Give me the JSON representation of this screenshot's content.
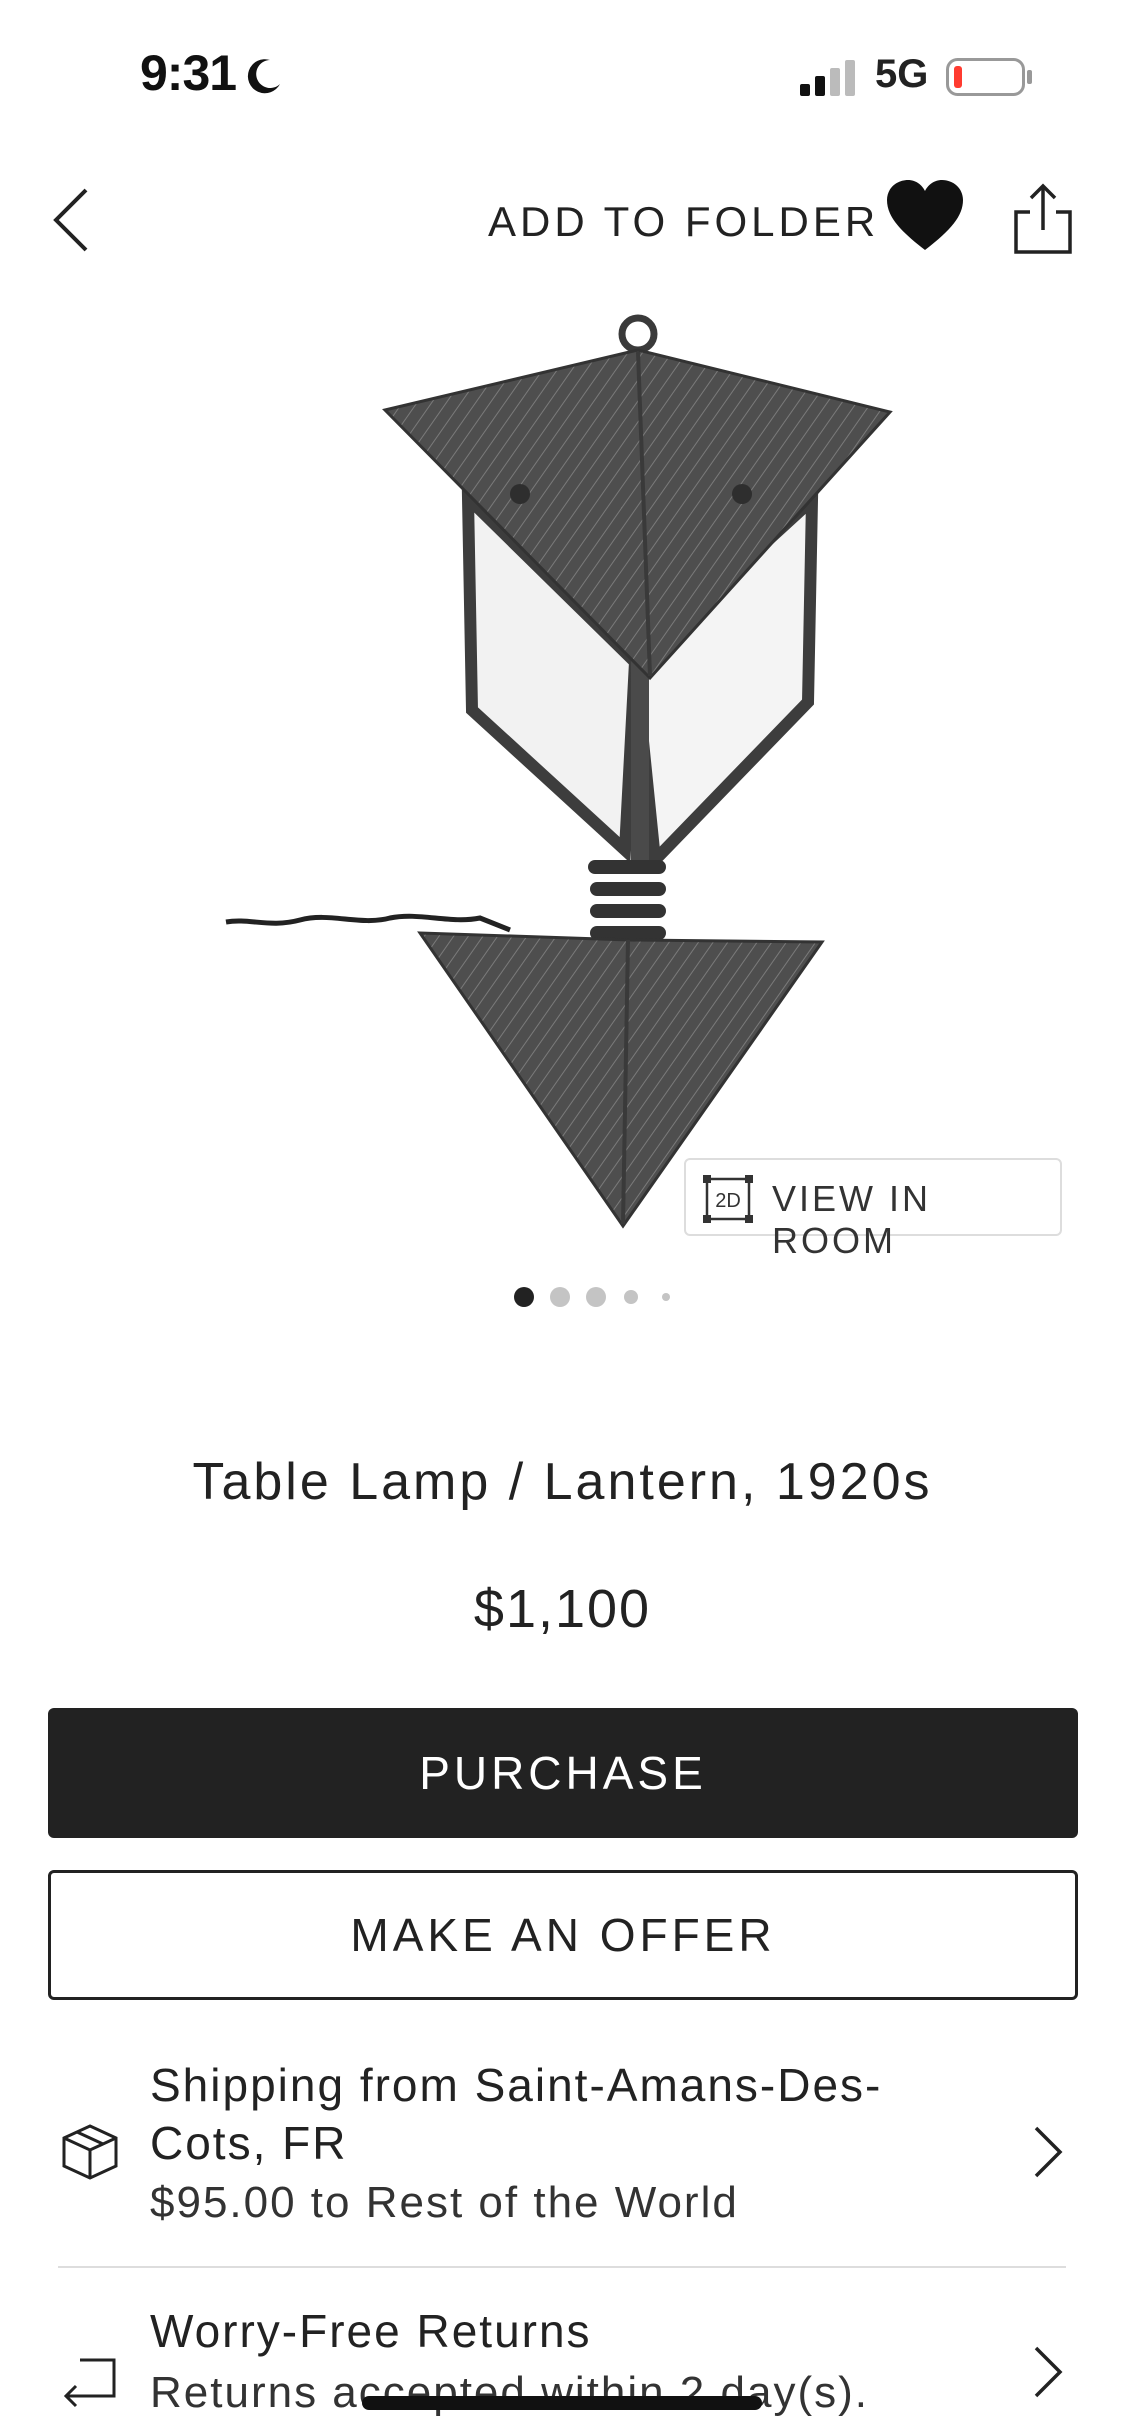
{
  "status_bar": {
    "time": "9:31",
    "network": "5G",
    "battery_color": "#ff3b30"
  },
  "nav": {
    "back_icon": "chevron-left-icon",
    "add_to_folder_label": "ADD TO FOLDER",
    "favorite_icon": "heart-icon",
    "share_icon": "share-icon"
  },
  "product": {
    "view_in_room_badge": "2D",
    "view_in_room_label": "VIEW IN ROOM",
    "image_count": 5,
    "active_image": 1,
    "title": "Table Lamp / Lantern, 1920s",
    "price": "$1,100"
  },
  "actions": {
    "purchase_label": "PURCHASE",
    "offer_label": "MAKE AN OFFER"
  },
  "shipping": {
    "icon": "package-icon",
    "title_line1": "Shipping from Saint-Amans-Des-",
    "title_line2": "Cots, FR",
    "cost": "$95.00 to Rest of the World"
  },
  "returns": {
    "icon": "return-arrow-icon",
    "title": "Worry-Free Returns",
    "detail": "Returns accepted within 2 day(s)."
  },
  "colors": {
    "primary_dark": "#222222",
    "divider": "#dddddd"
  }
}
